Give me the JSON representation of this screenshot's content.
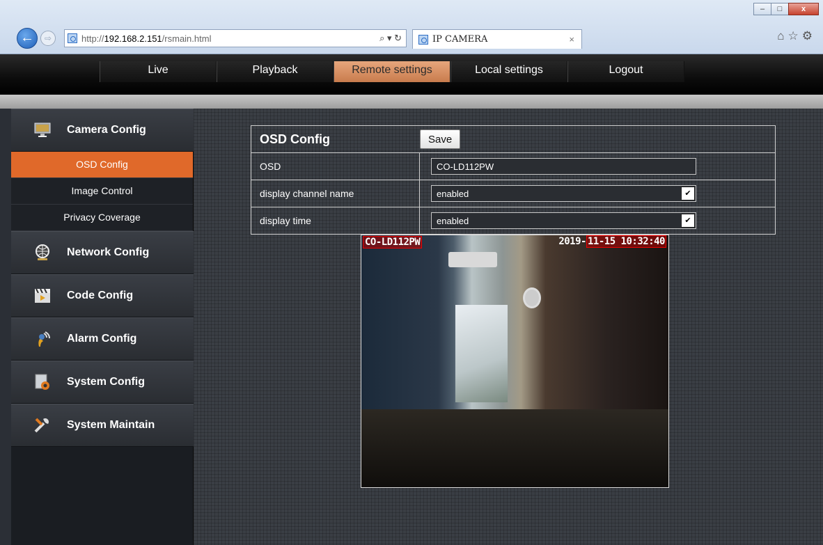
{
  "browser": {
    "url_prefix": "http://",
    "url_host": "192.168.2.151",
    "url_path": "/rsmain.html",
    "url_tools": "⌕ ▾ ↻",
    "tab_title": "IP CAMERA",
    "tab_close": "×",
    "minimize": "–",
    "maximize": "□",
    "close": "x",
    "back": "←",
    "forward": "⇨",
    "toolbar_icons": "⌂☆⚙"
  },
  "topnav": {
    "items": [
      {
        "label": "Live"
      },
      {
        "label": "Playback"
      },
      {
        "label": "Remote settings",
        "active": true
      },
      {
        "label": "Local settings"
      },
      {
        "label": "Logout"
      }
    ]
  },
  "sidebar": {
    "sections": [
      {
        "label": "Camera Config",
        "icon": "monitor-icon",
        "subitems": [
          {
            "label": "OSD Config",
            "active": true
          },
          {
            "label": "Image Control"
          },
          {
            "label": "Privacy Coverage"
          }
        ]
      },
      {
        "label": "Network Config",
        "icon": "globe-icon"
      },
      {
        "label": "Code Config",
        "icon": "film-icon"
      },
      {
        "label": "Alarm Config",
        "icon": "alarm-icon"
      },
      {
        "label": "System Config",
        "icon": "system-gear-icon"
      },
      {
        "label": "System Maintain",
        "icon": "tools-icon"
      }
    ]
  },
  "osd_config": {
    "title": "OSD Config",
    "save_label": "Save",
    "osd_label": "OSD",
    "osd_value": "CO-LD112PW",
    "channel_name_label": "display channel name",
    "channel_name_value": "enabled",
    "time_label": "display time",
    "time_value": "enabled",
    "select_arrow": "✔"
  },
  "preview": {
    "osd_name": "CO-LD112PW",
    "osd_date": "2019-",
    "osd_time": "11-15 10:32:40"
  },
  "colors": {
    "accent_orange": "#e0692a",
    "nav_active": "#d38a5c"
  }
}
